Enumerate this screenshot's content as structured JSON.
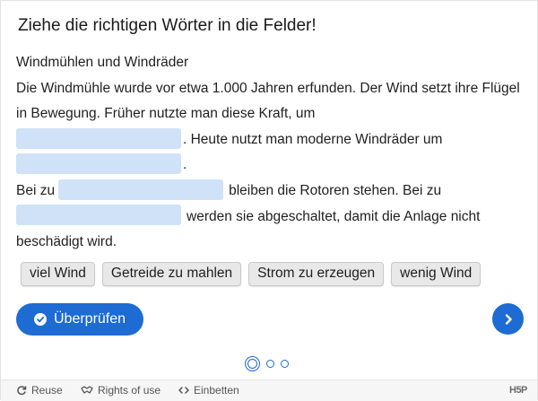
{
  "title": "Ziehe die richtigen Wörter in die Felder!",
  "text": {
    "heading": "Windmühlen und Windräder",
    "line1": "Die Windmühle wurde vor etwa 1.000 Jahren erfunden. Der Wind setzt ihre Flügel in Bewegung. Früher nutzte man diese Kraft, um",
    "after_blank1": ". Heute nutzt man moderne Windräder um",
    "after_blank2": ".",
    "before_blank3": "Bei zu",
    "after_blank3": "bleiben die Rotoren stehen. Bei zu",
    "after_blank4": "werden sie abgeschaltet, damit die Anlage nicht beschädigt wird."
  },
  "words": [
    "viel Wind",
    "Getreide zu mahlen",
    "Strom zu erzeugen",
    "wenig Wind"
  ],
  "buttons": {
    "check": "Überprüfen"
  },
  "footer": {
    "reuse": "Reuse",
    "rights": "Rights of use",
    "embed": "Einbetten",
    "logo": "H5P"
  },
  "colors": {
    "accent": "#1d6bd3",
    "blank": "#cfe2f7"
  },
  "pager": {
    "current": 1,
    "total": 3
  }
}
